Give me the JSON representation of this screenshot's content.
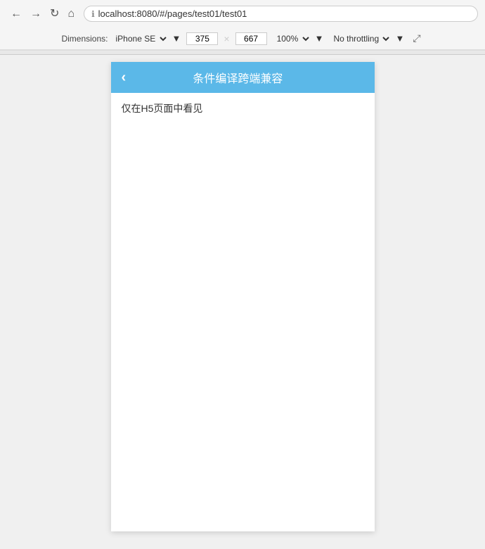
{
  "browser": {
    "address": "localhost:8080/#/pages/test01/test01",
    "lock_icon": "🔒"
  },
  "nav": {
    "back_label": "←",
    "forward_label": "→",
    "refresh_label": "↻",
    "home_label": "⌂"
  },
  "devtools_toolbar": {
    "dimensions_label": "Dimensions:",
    "device_select_value": "iPhone SE",
    "width_value": "375",
    "height_value": "667",
    "separator": "×",
    "zoom_value": "100%",
    "zoom_arrow": "▼",
    "throttle_label": "No throttling",
    "throttle_arrow": "▼",
    "rotate_icon": "⤢"
  },
  "mobile_page": {
    "back_icon": "‹",
    "title": "条件编译跨端兼容",
    "content_text": "仅在H5页面中看见"
  },
  "colors": {
    "header_bg": "#5bb8e8",
    "header_text": "#ffffff",
    "content_text": "#333333"
  }
}
